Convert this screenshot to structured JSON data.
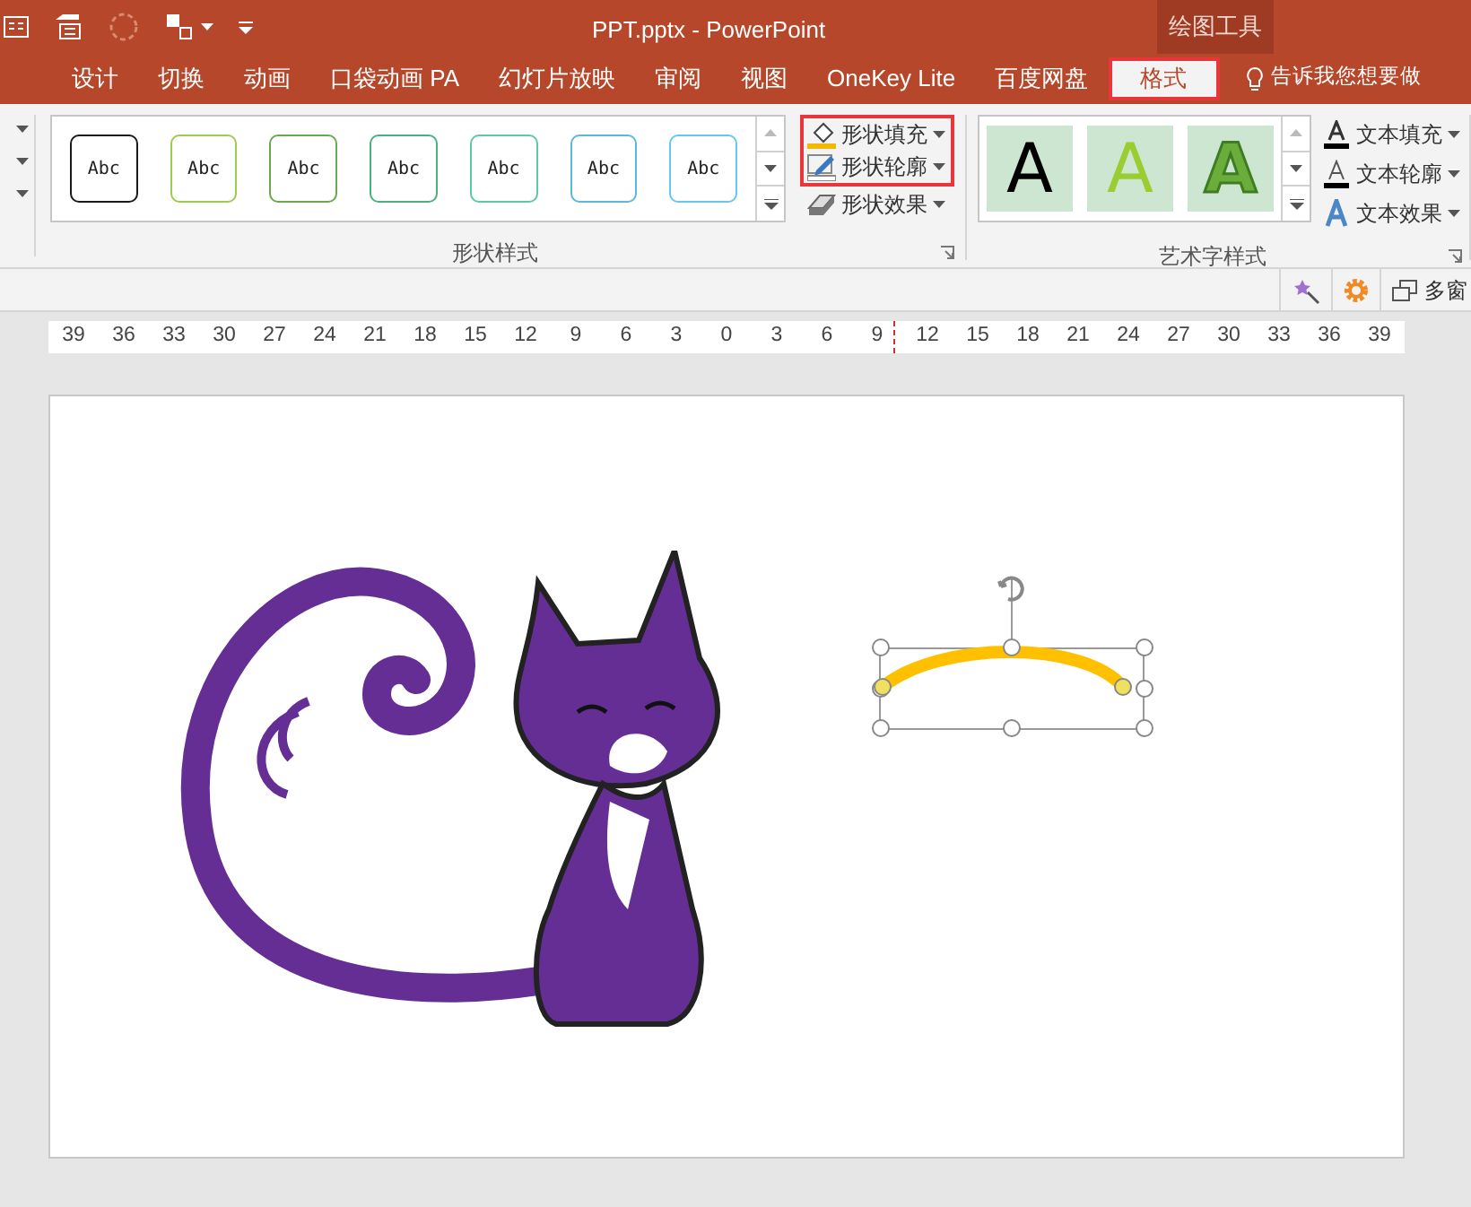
{
  "window": {
    "title": "PPT.pptx - PowerPoint"
  },
  "context_group": {
    "label": "绘图工具"
  },
  "tabs": [
    {
      "label": "设计",
      "selected": false
    },
    {
      "label": "切换",
      "selected": false
    },
    {
      "label": "动画",
      "selected": false
    },
    {
      "label": "口袋动画 PA",
      "selected": false
    },
    {
      "label": "幻灯片放映",
      "selected": false
    },
    {
      "label": "审阅",
      "selected": false
    },
    {
      "label": "视图",
      "selected": false
    },
    {
      "label": "OneKey Lite",
      "selected": false
    },
    {
      "label": "百度网盘",
      "selected": false
    },
    {
      "label": "格式",
      "selected": true
    }
  ],
  "tell_me": {
    "placeholder": "告诉我您想要做"
  },
  "shape_styles": {
    "label": "形状样式",
    "gallery": [
      {
        "text": "Abc",
        "color": "#1a1a1a"
      },
      {
        "text": "Abc",
        "color": "#9bcb4f"
      },
      {
        "text": "Abc",
        "color": "#6aa84f"
      },
      {
        "text": "Abc",
        "color": "#4caf7d"
      },
      {
        "text": "Abc",
        "color": "#5cc8a8"
      },
      {
        "text": "Abc",
        "color": "#5bb8d8"
      },
      {
        "text": "Abc",
        "color": "#67c6f0"
      }
    ],
    "commands": [
      {
        "kind": "fill",
        "label": "形状填充",
        "highlighted": true
      },
      {
        "kind": "outline",
        "label": "形状轮廓",
        "highlighted": true
      },
      {
        "kind": "effect",
        "label": "形状效果",
        "highlighted": false
      }
    ]
  },
  "wordart_styles": {
    "label": "艺术字样式",
    "gallery": [
      {
        "kind": "solid",
        "text": "A",
        "color": "#000000"
      },
      {
        "kind": "solid",
        "text": "A",
        "color": "#9acd32"
      },
      {
        "kind": "outline",
        "text": "A",
        "color": "#6aad3a"
      }
    ],
    "commands": [
      {
        "kind": "fill",
        "label": "文本填充"
      },
      {
        "kind": "outline",
        "label": "文本轮廓"
      },
      {
        "kind": "effect",
        "label": "文本效果"
      }
    ]
  },
  "secondary_toolbar": {
    "window_label": "多窗"
  },
  "ruler": [
    "39",
    "36",
    "33",
    "30",
    "27",
    "24",
    "21",
    "18",
    "15",
    "12",
    "9",
    "6",
    "3",
    "0",
    "3",
    "6",
    "9",
    "12",
    "15",
    "18",
    "21",
    "24",
    "27",
    "30",
    "33",
    "36",
    "39"
  ]
}
